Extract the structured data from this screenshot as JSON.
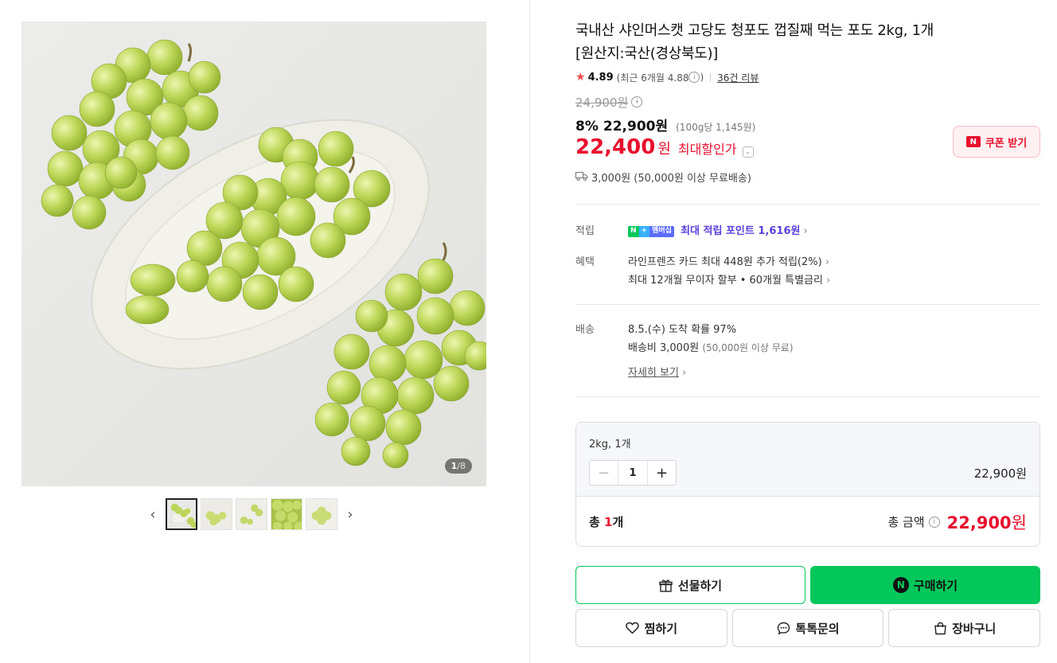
{
  "gallery": {
    "counter_current": "1",
    "counter_total": "/8",
    "prev_arrow": "‹",
    "next_arrow": "›",
    "thumbnail_count": 5
  },
  "product": {
    "title_line1": "국내산 샤인머스캣 고당도 청포도 껍질째 먹는 포도 2kg, 1개",
    "title_line2": "[원산지:국산(경상북도)]",
    "rating": "4.89",
    "rating_recent": "(최근 6개월 4.88",
    "rating_recent_close": ")",
    "review_count": "36건 리뷰",
    "original_price": "24,900원",
    "discount_rate": "8%",
    "sale_price": "22,900원",
    "unit_price": "(100g당 1,145원)",
    "max_discount_price": "22,400",
    "max_discount_won": "원",
    "max_discount_label": "최대할인가",
    "coupon_button": "쿠폰 받기",
    "coupon_n": "N",
    "delivery": "3,000원 (50,000원 이상 무료배송)"
  },
  "points": {
    "label": "적립",
    "badge_n": "N",
    "badge_plus": "+",
    "badge_member": "멤버십",
    "text": "최대 적립 포인트 1,616원"
  },
  "benefits": {
    "label": "혜택",
    "line1": "라인프렌즈 카드 최대 448원 추가 적립(2%)",
    "line2": "최대 12개월 무이자 할부 • 60개월 특별금리"
  },
  "shipping": {
    "label": "배송",
    "line1": "8.5.(수) 도착 확률 97%",
    "line2_main": "배송비 3,000원",
    "line2_sub": "(50,000원 이상 무료)",
    "details_link": "자세히 보기"
  },
  "option": {
    "name": "2kg, 1개",
    "quantity": "1",
    "price": "22,900원",
    "total_label": "총",
    "total_count": "1",
    "total_count_unit": "개",
    "total_amount_label": "총 금액",
    "total_amount": "22,900",
    "total_amount_won": "원"
  },
  "buttons": {
    "gift": "선물하기",
    "buy": "구매하기",
    "wish": "찜하기",
    "talk": "톡톡문의",
    "cart": "장바구니"
  },
  "colors": {
    "accent_red": "#e8102e",
    "naver_green": "#03c75a",
    "point_purple": "#5b3fdc"
  }
}
